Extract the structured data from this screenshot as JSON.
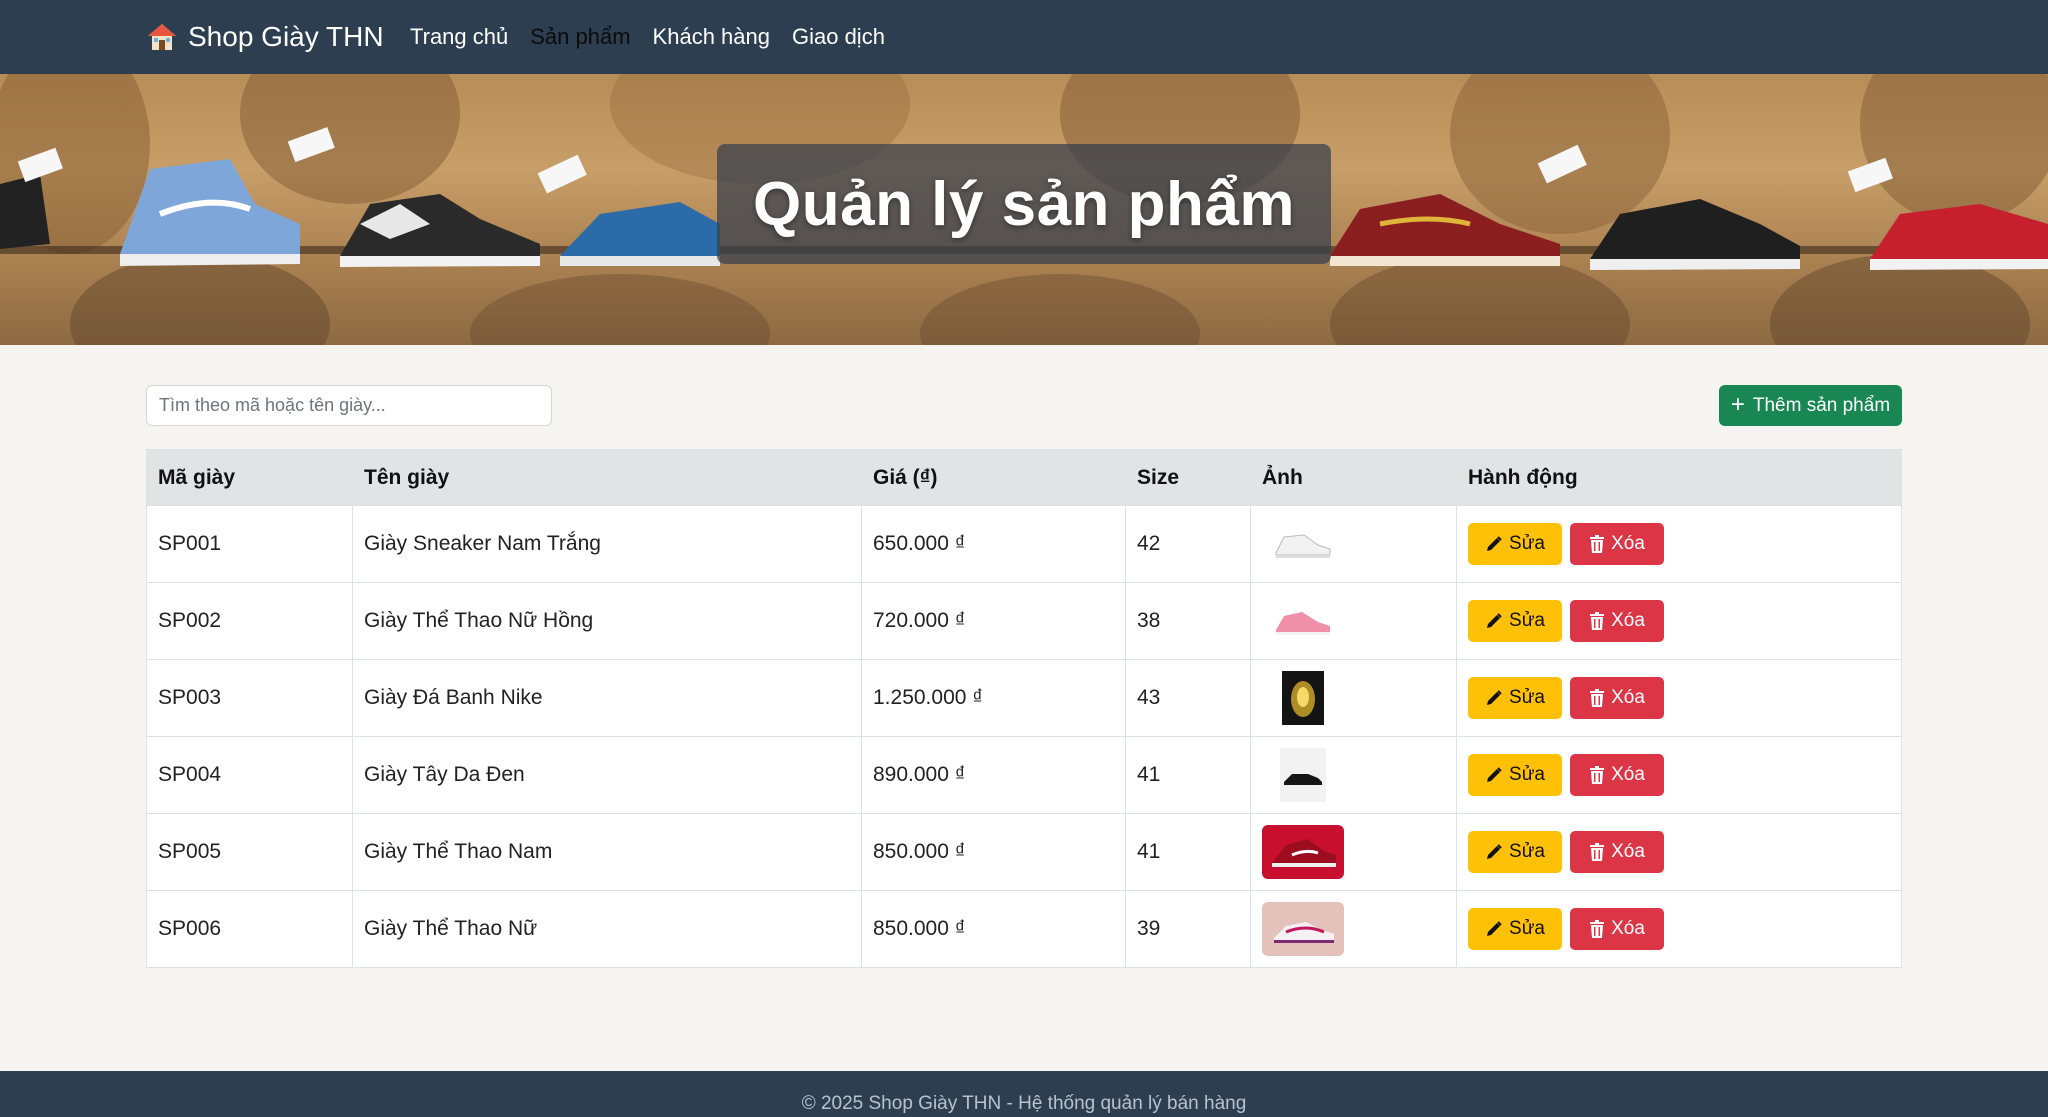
{
  "navbar": {
    "brand_icon": "house-icon",
    "brand": "Shop Giày THN",
    "links": [
      {
        "label": "Trang chủ",
        "active": false
      },
      {
        "label": "Sản phẩm",
        "active": true
      },
      {
        "label": "Khách hàng",
        "active": false
      },
      {
        "label": "Giao dịch",
        "active": false
      }
    ]
  },
  "hero": {
    "title": "Quản lý sản phẩm"
  },
  "toolbar": {
    "search_placeholder": "Tìm theo mã hoặc tên giày...",
    "search_value": "",
    "add_label": "Thêm sản phẩm",
    "add_icon": "plus-icon"
  },
  "table": {
    "headers": [
      "Mã giày",
      "Tên giày",
      "Giá (₫)",
      "Size",
      "Ảnh",
      "Hành động"
    ],
    "edit_label": "Sửa",
    "delete_label": "Xóa",
    "edit_icon": "pencil-icon",
    "delete_icon": "trash-icon",
    "rows": [
      {
        "code": "SP001",
        "name": "Giày Sneaker Nam Trắng",
        "price": "650.000 ₫",
        "size": "42",
        "image": "white-sneaker-image"
      },
      {
        "code": "SP002",
        "name": "Giày Thể Thao Nữ Hồng",
        "price": "720.000 ₫",
        "size": "38",
        "image": "pink-sneaker-image"
      },
      {
        "code": "SP003",
        "name": "Giày Đá Banh Nike",
        "price": "1.250.000 ₫",
        "size": "43",
        "image": "football-boot-image"
      },
      {
        "code": "SP004",
        "name": "Giày Tây Da Đen",
        "price": "890.000 ₫",
        "size": "41",
        "image": "black-leather-shoe-image"
      },
      {
        "code": "SP005",
        "name": "Giày Thể Thao Nam",
        "price": "850.000 ₫",
        "size": "41",
        "image": "red-running-shoe-image"
      },
      {
        "code": "SP006",
        "name": "Giày Thể Thao Nữ",
        "price": "850.000 ₫",
        "size": "39",
        "image": "pastel-running-shoe-image"
      }
    ]
  },
  "colors": {
    "navbar": "#2c3e50",
    "add_button": "#198754",
    "edit_button": "#ffc107",
    "delete_button": "#dc3545",
    "table_header": "#e2e3e5"
  },
  "footer": {
    "text": "© 2025 Shop Giày THN - Hệ thống quản lý bán hàng"
  }
}
